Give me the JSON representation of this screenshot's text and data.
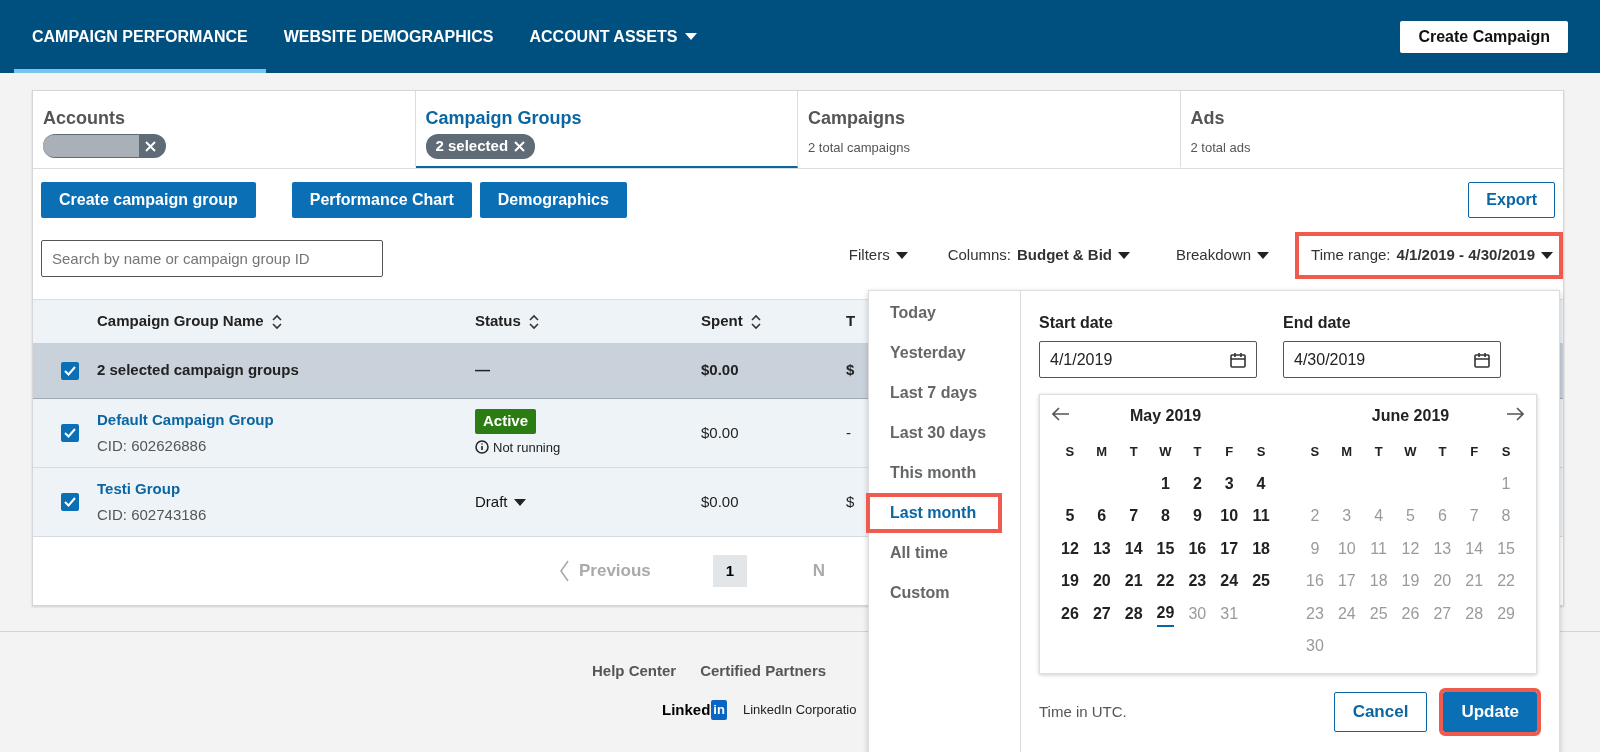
{
  "navbar": {
    "tabs": [
      {
        "label": "CAMPAIGN PERFORMANCE",
        "selected": true,
        "dropdown": false
      },
      {
        "label": "WEBSITE DEMOGRAPHICS",
        "selected": false,
        "dropdown": false
      },
      {
        "label": "ACCOUNT ASSETS",
        "selected": false,
        "dropdown": true
      }
    ],
    "create_button": "Create Campaign"
  },
  "level_tabs": [
    {
      "title": "Accounts",
      "selected": false,
      "chip": {
        "redacted": true
      }
    },
    {
      "title": "Campaign Groups",
      "selected": true,
      "chip": {
        "label": "2 selected",
        "redacted": false
      }
    },
    {
      "title": "Campaigns",
      "selected": false,
      "subtitle": "2 total campaigns"
    },
    {
      "title": "Ads",
      "selected": false,
      "subtitle": "2 total ads"
    }
  ],
  "actions": [
    "Create campaign group",
    "Performance Chart",
    "Demographics"
  ],
  "export_button": "Export",
  "search": {
    "placeholder": "Search by name or campaign group ID"
  },
  "toolbar": {
    "filters": "Filters",
    "columns_label": "Columns:",
    "columns_value": "Budget & Bid",
    "breakdown": "Breakdown",
    "time_label": "Time range:",
    "time_value": "4/1/2019 - 4/30/2019",
    "time_highlighted": true
  },
  "table": {
    "columns": [
      {
        "label": "Campaign Group Name",
        "sortable": true
      },
      {
        "label": "Status",
        "sortable": true
      },
      {
        "label": "Spent",
        "sortable": true
      },
      {
        "label": "T",
        "sortable": false
      }
    ],
    "summary": {
      "checked": true,
      "name": "2 selected campaign groups",
      "status": "—",
      "spent": "$0.00",
      "column_4": "$"
    },
    "rows": [
      {
        "checked": true,
        "name": "Default Campaign Group",
        "cid": "CID: 602626886",
        "kind": "badge",
        "status": "Active",
        "status_note": "Not running",
        "spent": "$0.00",
        "column_4": "-"
      },
      {
        "checked": true,
        "name": "Testi Group",
        "cid": "CID: 602743186",
        "kind": "dropdown",
        "status": "Draft",
        "spent": "$0.00",
        "column_4": "$"
      }
    ]
  },
  "pagination": {
    "previous": "Previous",
    "pages": [
      {
        "label": "1",
        "selected": true
      }
    ],
    "next": "N"
  },
  "footer": {
    "links": [
      "Help Center",
      "Certified Partners"
    ],
    "logo_word": "Linked",
    "logo_box": "in",
    "copyright": "LinkedIn Corporatio"
  },
  "date_popup": {
    "presets": [
      {
        "label": "Today",
        "selected": false,
        "highlighted": false
      },
      {
        "label": "Yesterday",
        "selected": false,
        "highlighted": false
      },
      {
        "label": "Last 7 days",
        "selected": false,
        "highlighted": false
      },
      {
        "label": "Last 30 days",
        "selected": false,
        "highlighted": false
      },
      {
        "label": "This month",
        "selected": false,
        "highlighted": false
      },
      {
        "label": "Last month",
        "selected": true,
        "highlighted": true
      },
      {
        "label": "All time",
        "selected": false,
        "highlighted": false
      },
      {
        "label": "Custom",
        "selected": false,
        "highlighted": false
      }
    ],
    "start": {
      "label": "Start date",
      "value": "4/1/2019"
    },
    "end": {
      "label": "End date",
      "value": "4/30/2019"
    },
    "months": [
      {
        "title": "May 2019",
        "weekdays": [
          "S",
          "M",
          "T",
          "W",
          "T",
          "F",
          "S"
        ],
        "weeks": [
          [
            {
              "label": "1",
              "disabled": false,
              "today": false
            },
            {
              "label": "2",
              "disabled": false,
              "today": false
            },
            {
              "label": "3",
              "disabled": false,
              "today": false
            },
            {
              "label": "4",
              "disabled": false,
              "today": false
            }
          ],
          [
            {
              "label": "5",
              "disabled": false,
              "today": false
            },
            {
              "label": "6",
              "disabled": false,
              "today": false
            },
            {
              "label": "7",
              "disabled": false,
              "today": false
            },
            {
              "label": "8",
              "disabled": false,
              "today": false
            },
            {
              "label": "9",
              "disabled": false,
              "today": false
            },
            {
              "label": "10",
              "disabled": false,
              "today": false
            },
            {
              "label": "11",
              "disabled": false,
              "today": false
            }
          ],
          [
            {
              "label": "12",
              "disabled": false,
              "today": false
            },
            {
              "label": "13",
              "disabled": false,
              "today": false
            },
            {
              "label": "14",
              "disabled": false,
              "today": false
            },
            {
              "label": "15",
              "disabled": false,
              "today": false
            },
            {
              "label": "16",
              "disabled": false,
              "today": false
            },
            {
              "label": "17",
              "disabled": false,
              "today": false
            },
            {
              "label": "18",
              "disabled": false,
              "today": false
            }
          ],
          [
            {
              "label": "19",
              "disabled": false,
              "today": false
            },
            {
              "label": "20",
              "disabled": false,
              "today": false
            },
            {
              "label": "21",
              "disabled": false,
              "today": false
            },
            {
              "label": "22",
              "disabled": false,
              "today": false
            },
            {
              "label": "23",
              "disabled": false,
              "today": false
            },
            {
              "label": "24",
              "disabled": false,
              "today": false
            },
            {
              "label": "25",
              "disabled": false,
              "today": false
            }
          ],
          [
            {
              "label": "26",
              "disabled": false,
              "today": false
            },
            {
              "label": "27",
              "disabled": false,
              "today": false
            },
            {
              "label": "28",
              "disabled": false,
              "today": false
            },
            {
              "label": "29",
              "disabled": false,
              "today": true
            },
            {
              "label": "30",
              "disabled": true,
              "today": false
            },
            {
              "label": "31",
              "disabled": true,
              "today": false
            }
          ]
        ]
      },
      {
        "title": "June 2019",
        "weekdays": [
          "S",
          "M",
          "T",
          "W",
          "T",
          "F",
          "S"
        ],
        "weeks": [
          [
            {
              "label": "1",
              "disabled": true,
              "today": false
            }
          ],
          [
            {
              "label": "2",
              "disabled": true,
              "today": false
            },
            {
              "label": "3",
              "disabled": true,
              "today": false
            },
            {
              "label": "4",
              "disabled": true,
              "today": false
            },
            {
              "label": "5",
              "disabled": true,
              "today": false
            },
            {
              "label": "6",
              "disabled": true,
              "today": false
            },
            {
              "label": "7",
              "disabled": true,
              "today": false
            },
            {
              "label": "8",
              "disabled": true,
              "today": false
            }
          ],
          [
            {
              "label": "9",
              "disabled": true,
              "today": false
            },
            {
              "label": "10",
              "disabled": true,
              "today": false
            },
            {
              "label": "11",
              "disabled": true,
              "today": false
            },
            {
              "label": "12",
              "disabled": true,
              "today": false
            },
            {
              "label": "13",
              "disabled": true,
              "today": false
            },
            {
              "label": "14",
              "disabled": true,
              "today": false
            },
            {
              "label": "15",
              "disabled": true,
              "today": false
            }
          ],
          [
            {
              "label": "16",
              "disabled": true,
              "today": false
            },
            {
              "label": "17",
              "disabled": true,
              "today": false
            },
            {
              "label": "18",
              "disabled": true,
              "today": false
            },
            {
              "label": "19",
              "disabled": true,
              "today": false
            },
            {
              "label": "20",
              "disabled": true,
              "today": false
            },
            {
              "label": "21",
              "disabled": true,
              "today": false
            },
            {
              "label": "22",
              "disabled": true,
              "today": false
            }
          ],
          [
            {
              "label": "23",
              "disabled": true,
              "today": false
            },
            {
              "label": "24",
              "disabled": true,
              "today": false
            },
            {
              "label": "25",
              "disabled": true,
              "today": false
            },
            {
              "label": "26",
              "disabled": true,
              "today": false
            },
            {
              "label": "27",
              "disabled": true,
              "today": false
            },
            {
              "label": "28",
              "disabled": true,
              "today": false
            },
            {
              "label": "29",
              "disabled": true,
              "today": false
            }
          ],
          [
            {
              "label": "30",
              "disabled": true,
              "today": false
            }
          ]
        ]
      }
    ],
    "timezone_note": "Time in UTC.",
    "buttons": [
      {
        "label": "Cancel",
        "kind": "secondary",
        "highlighted": false
      },
      {
        "label": "Update",
        "kind": "primary",
        "highlighted": true
      }
    ]
  }
}
